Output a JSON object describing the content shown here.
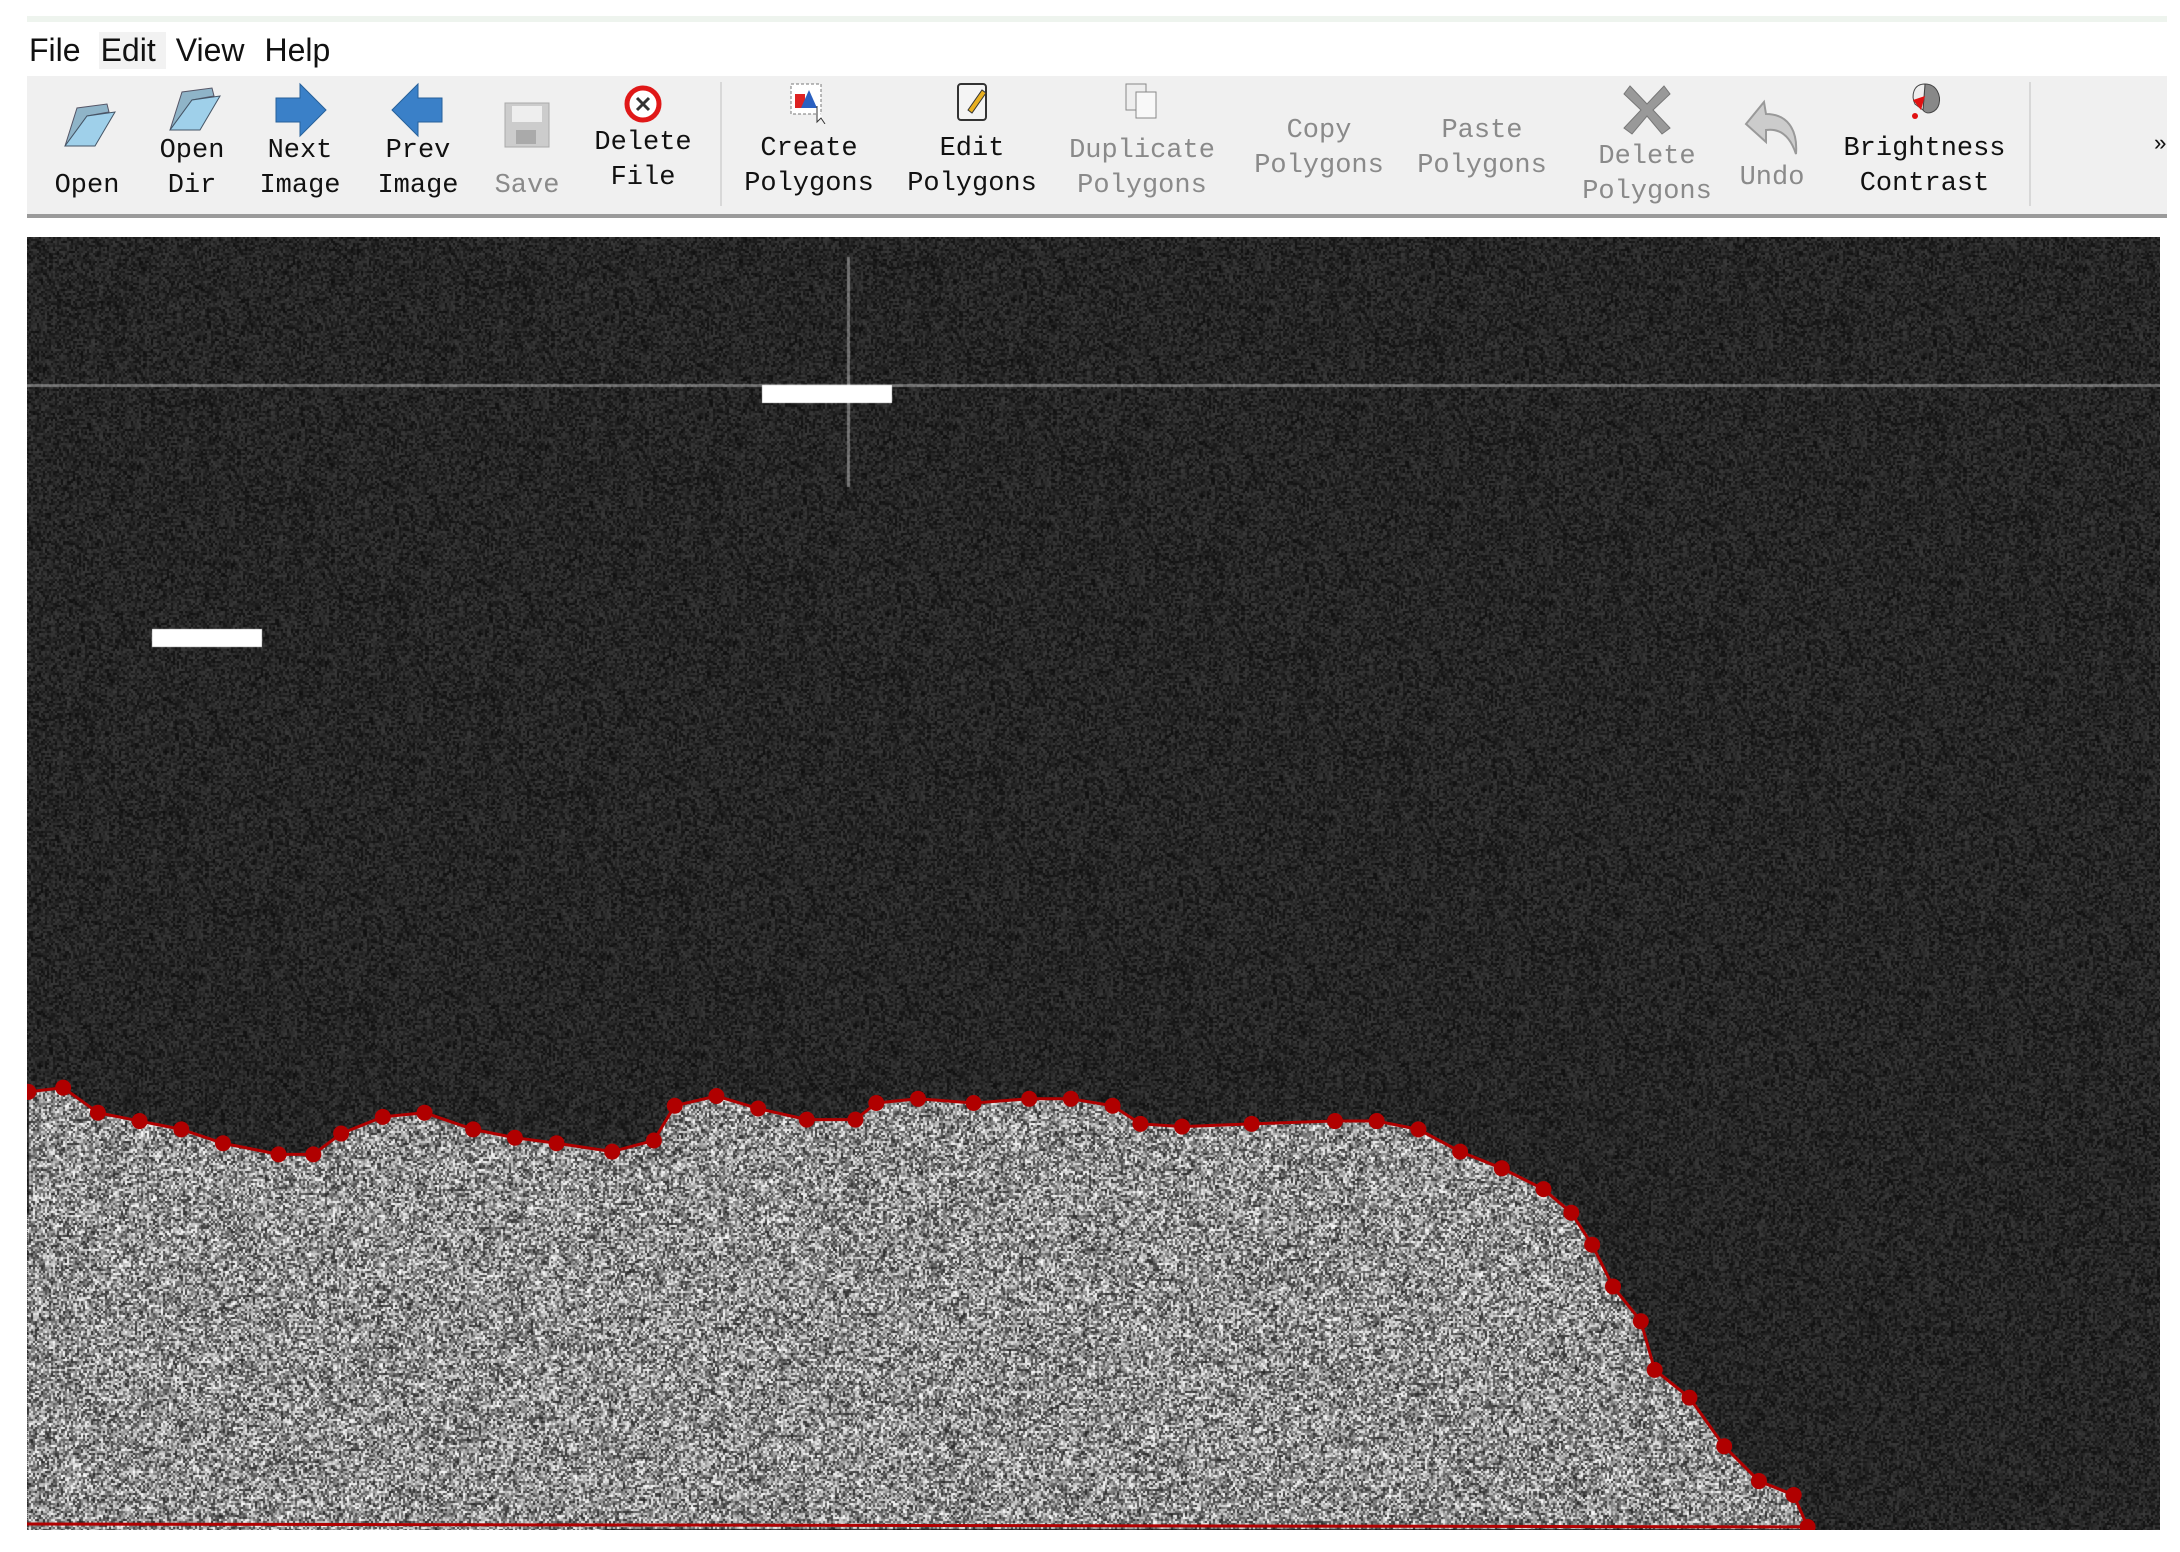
{
  "menu": [
    "File",
    "Edit",
    "View",
    "Help"
  ],
  "toolbar": {
    "open": "Open",
    "open_dir": "Open\nDir",
    "next_image": "Next\nImage",
    "prev_image": "Prev\nImage",
    "save": "Save",
    "delete_file": "Delete\nFile",
    "create_polygons": "Create\nPolygons",
    "edit_polygons": "Edit\nPolygons",
    "duplicate_polygons": "Duplicate\nPolygons",
    "copy_polygons": "Copy\nPolygons",
    "paste_polygons": "Paste\nPolygons",
    "delete_polygons": "Delete\nPolygons",
    "undo": "Undo",
    "brightness_contrast": "Brightness\nContrast",
    "more": "»"
  },
  "colors": {
    "polygon": "#b00000",
    "toolbar_bg": "#f0f0f0",
    "disabled_text": "#8a8a8a"
  }
}
